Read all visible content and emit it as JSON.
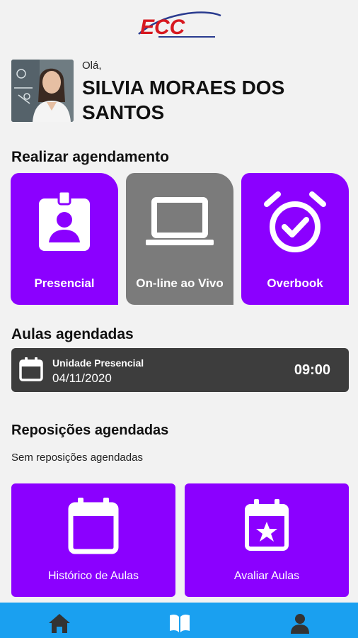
{
  "app": {
    "logo_text": "ECC"
  },
  "profile": {
    "greeting": "Olá,",
    "name": "SILVIA MORAES DOS SANTOS"
  },
  "scheduling": {
    "title": "Realizar agendamento",
    "options": [
      {
        "label": "Presencial",
        "icon": "badge-person-icon",
        "color": "#8b00ff"
      },
      {
        "label": "On-line ao Vivo",
        "icon": "laptop-icon",
        "color": "#7b7b7b"
      },
      {
        "label": "Overbook",
        "icon": "alarm-check-icon",
        "color": "#8b00ff"
      }
    ]
  },
  "scheduled_classes": {
    "title": "Aulas agendadas",
    "items": [
      {
        "unit": "Unidade Presencial",
        "date": "04/11/2020",
        "time": "09:00",
        "icon": "calendar-icon"
      }
    ]
  },
  "replacements": {
    "title": "Reposições agendadas",
    "empty_text": "Sem reposições agendadas"
  },
  "actions": [
    {
      "label": "Histórico de Aulas",
      "icon": "calendar-icon"
    },
    {
      "label": "Avaliar Aulas",
      "icon": "calendar-star-icon"
    }
  ],
  "bottom_nav": [
    {
      "icon": "home-icon"
    },
    {
      "icon": "book-icon"
    },
    {
      "icon": "user-icon"
    }
  ],
  "colors": {
    "accent": "#8b00ff",
    "inactive": "#7b7b7b",
    "nav_bar": "#1aa0f0",
    "lesson_card": "#3d3d3d"
  }
}
